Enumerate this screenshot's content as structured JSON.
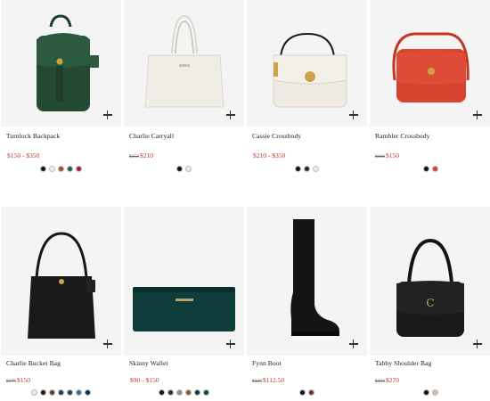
{
  "products": [
    {
      "name": "Turnlock Backpack",
      "old_price": "",
      "price": "$150 - $350",
      "swatches": [
        "#111111",
        "#efefe9",
        "#a0522d",
        "#2f5a3c",
        "#b3144f"
      ]
    },
    {
      "name": "Charlie Carryall",
      "old_price": "$350",
      "price": "$210",
      "swatches": [
        "#111111",
        "#efece6"
      ]
    },
    {
      "name": "Cassie Crossbody",
      "old_price": "",
      "price": "$210 - $350",
      "swatches": [
        "#111111",
        "#2b2b2b",
        "#efece6"
      ]
    },
    {
      "name": "Rambler Crossbody",
      "old_price": "$300",
      "price": "$150",
      "swatches": [
        "#111111",
        "#d8432f"
      ]
    },
    {
      "name": "Charlie Bucket Bag",
      "old_price": "$375",
      "price": "$150",
      "swatches": [
        "#efece6",
        "#1c1c1c",
        "#6b3b2a",
        "#1d3a5c",
        "#2f3b52",
        "#2f6fa7",
        "#0b2a46"
      ]
    },
    {
      "name": "Skinny Wallet",
      "old_price": "",
      "price": "$90 - $150",
      "swatches": [
        "#111111",
        "#3a2a2a",
        "#8c8c8c",
        "#8a5a3a",
        "#0f3d3b",
        "#12433f"
      ]
    },
    {
      "name": "Fynn Boot",
      "old_price": "$225",
      "price": "$112.50",
      "swatches": [
        "#111111",
        "#6a3a2a"
      ]
    },
    {
      "name": "Tabby Shoulder Bag",
      "old_price": "$450",
      "price": "$270",
      "swatches": [
        "#111111",
        "#d9b79a"
      ]
    }
  ]
}
